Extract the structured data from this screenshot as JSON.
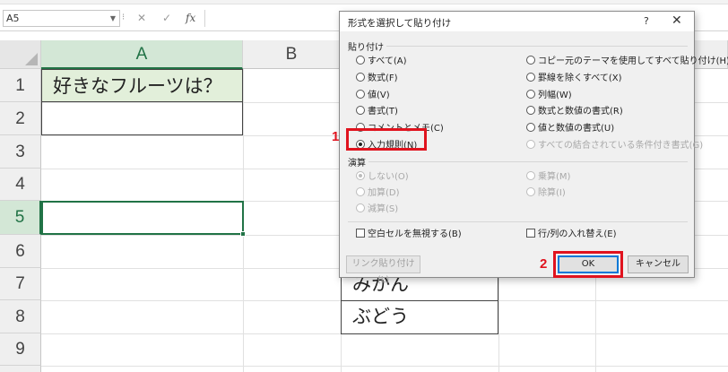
{
  "formula_bar": {
    "name_box": "A5",
    "cancel_icon": "✕",
    "enter_icon": "✓",
    "fx_label": "fx"
  },
  "columns": [
    "A",
    "B"
  ],
  "rows": [
    "1",
    "2",
    "3",
    "4",
    "5",
    "6",
    "7",
    "8",
    "9"
  ],
  "cells": {
    "A1": "好きなフルーツは？",
    "C7": "みかん",
    "C8": "ぶどう"
  },
  "dialog": {
    "title": "形式を選択して貼り付け",
    "help": "?",
    "close": "✕",
    "paste_section": "貼り付け",
    "paste_options_left": [
      "すべて(A)",
      "数式(F)",
      "値(V)",
      "書式(T)",
      "コメントとメモ(C)",
      "入力規則(N)"
    ],
    "paste_options_right": [
      "コピー元のテーマを使用してすべて貼り付け(H)",
      "罫線を除くすべて(X)",
      "列幅(W)",
      "数式と数値の書式(R)",
      "値と数値の書式(U)",
      "すべての結合されている条件付き書式(G)"
    ],
    "selected_paste": "入力規則(N)",
    "operation_section": "演算",
    "operation_left": [
      "しない(O)",
      "加算(D)",
      "減算(S)"
    ],
    "operation_right": [
      "乗算(M)",
      "除算(I)"
    ],
    "skip_blanks": "空白セルを無視する(B)",
    "transpose": "行/列の入れ替え(E)",
    "paste_link": "リンク貼り付け(L)",
    "ok": "OK",
    "cancel": "キャンセル"
  },
  "annotations": {
    "step1": "1",
    "step2": "2",
    "color": "#e0131e"
  },
  "colors": {
    "excel_green": "#217346",
    "header_cell_fill": "#e2efda"
  }
}
